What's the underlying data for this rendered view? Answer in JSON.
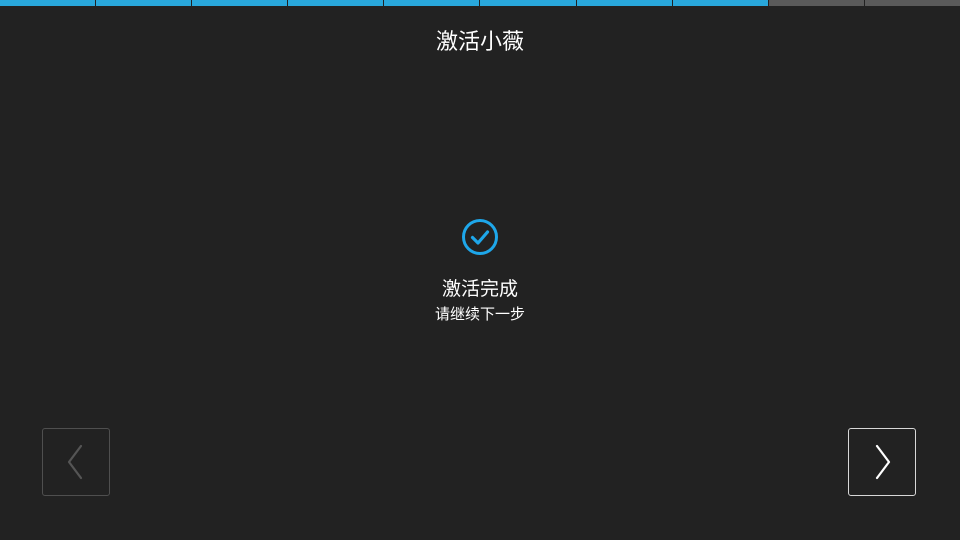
{
  "header": {
    "title": "激活小薇"
  },
  "progress": {
    "total_steps": 10,
    "completed_steps": 8,
    "active_color": "#29a8dc",
    "inactive_color": "#5a5a5a"
  },
  "status": {
    "icon": "check-circle-icon",
    "icon_color": "#1ea7ea",
    "title": "激活完成",
    "subtitle": "请继续下一步"
  },
  "navigation": {
    "prev_icon": "chevron-left-icon",
    "prev_enabled": false,
    "prev_color": "#555555",
    "next_icon": "chevron-right-icon",
    "next_enabled": true,
    "next_color": "#ffffff"
  }
}
